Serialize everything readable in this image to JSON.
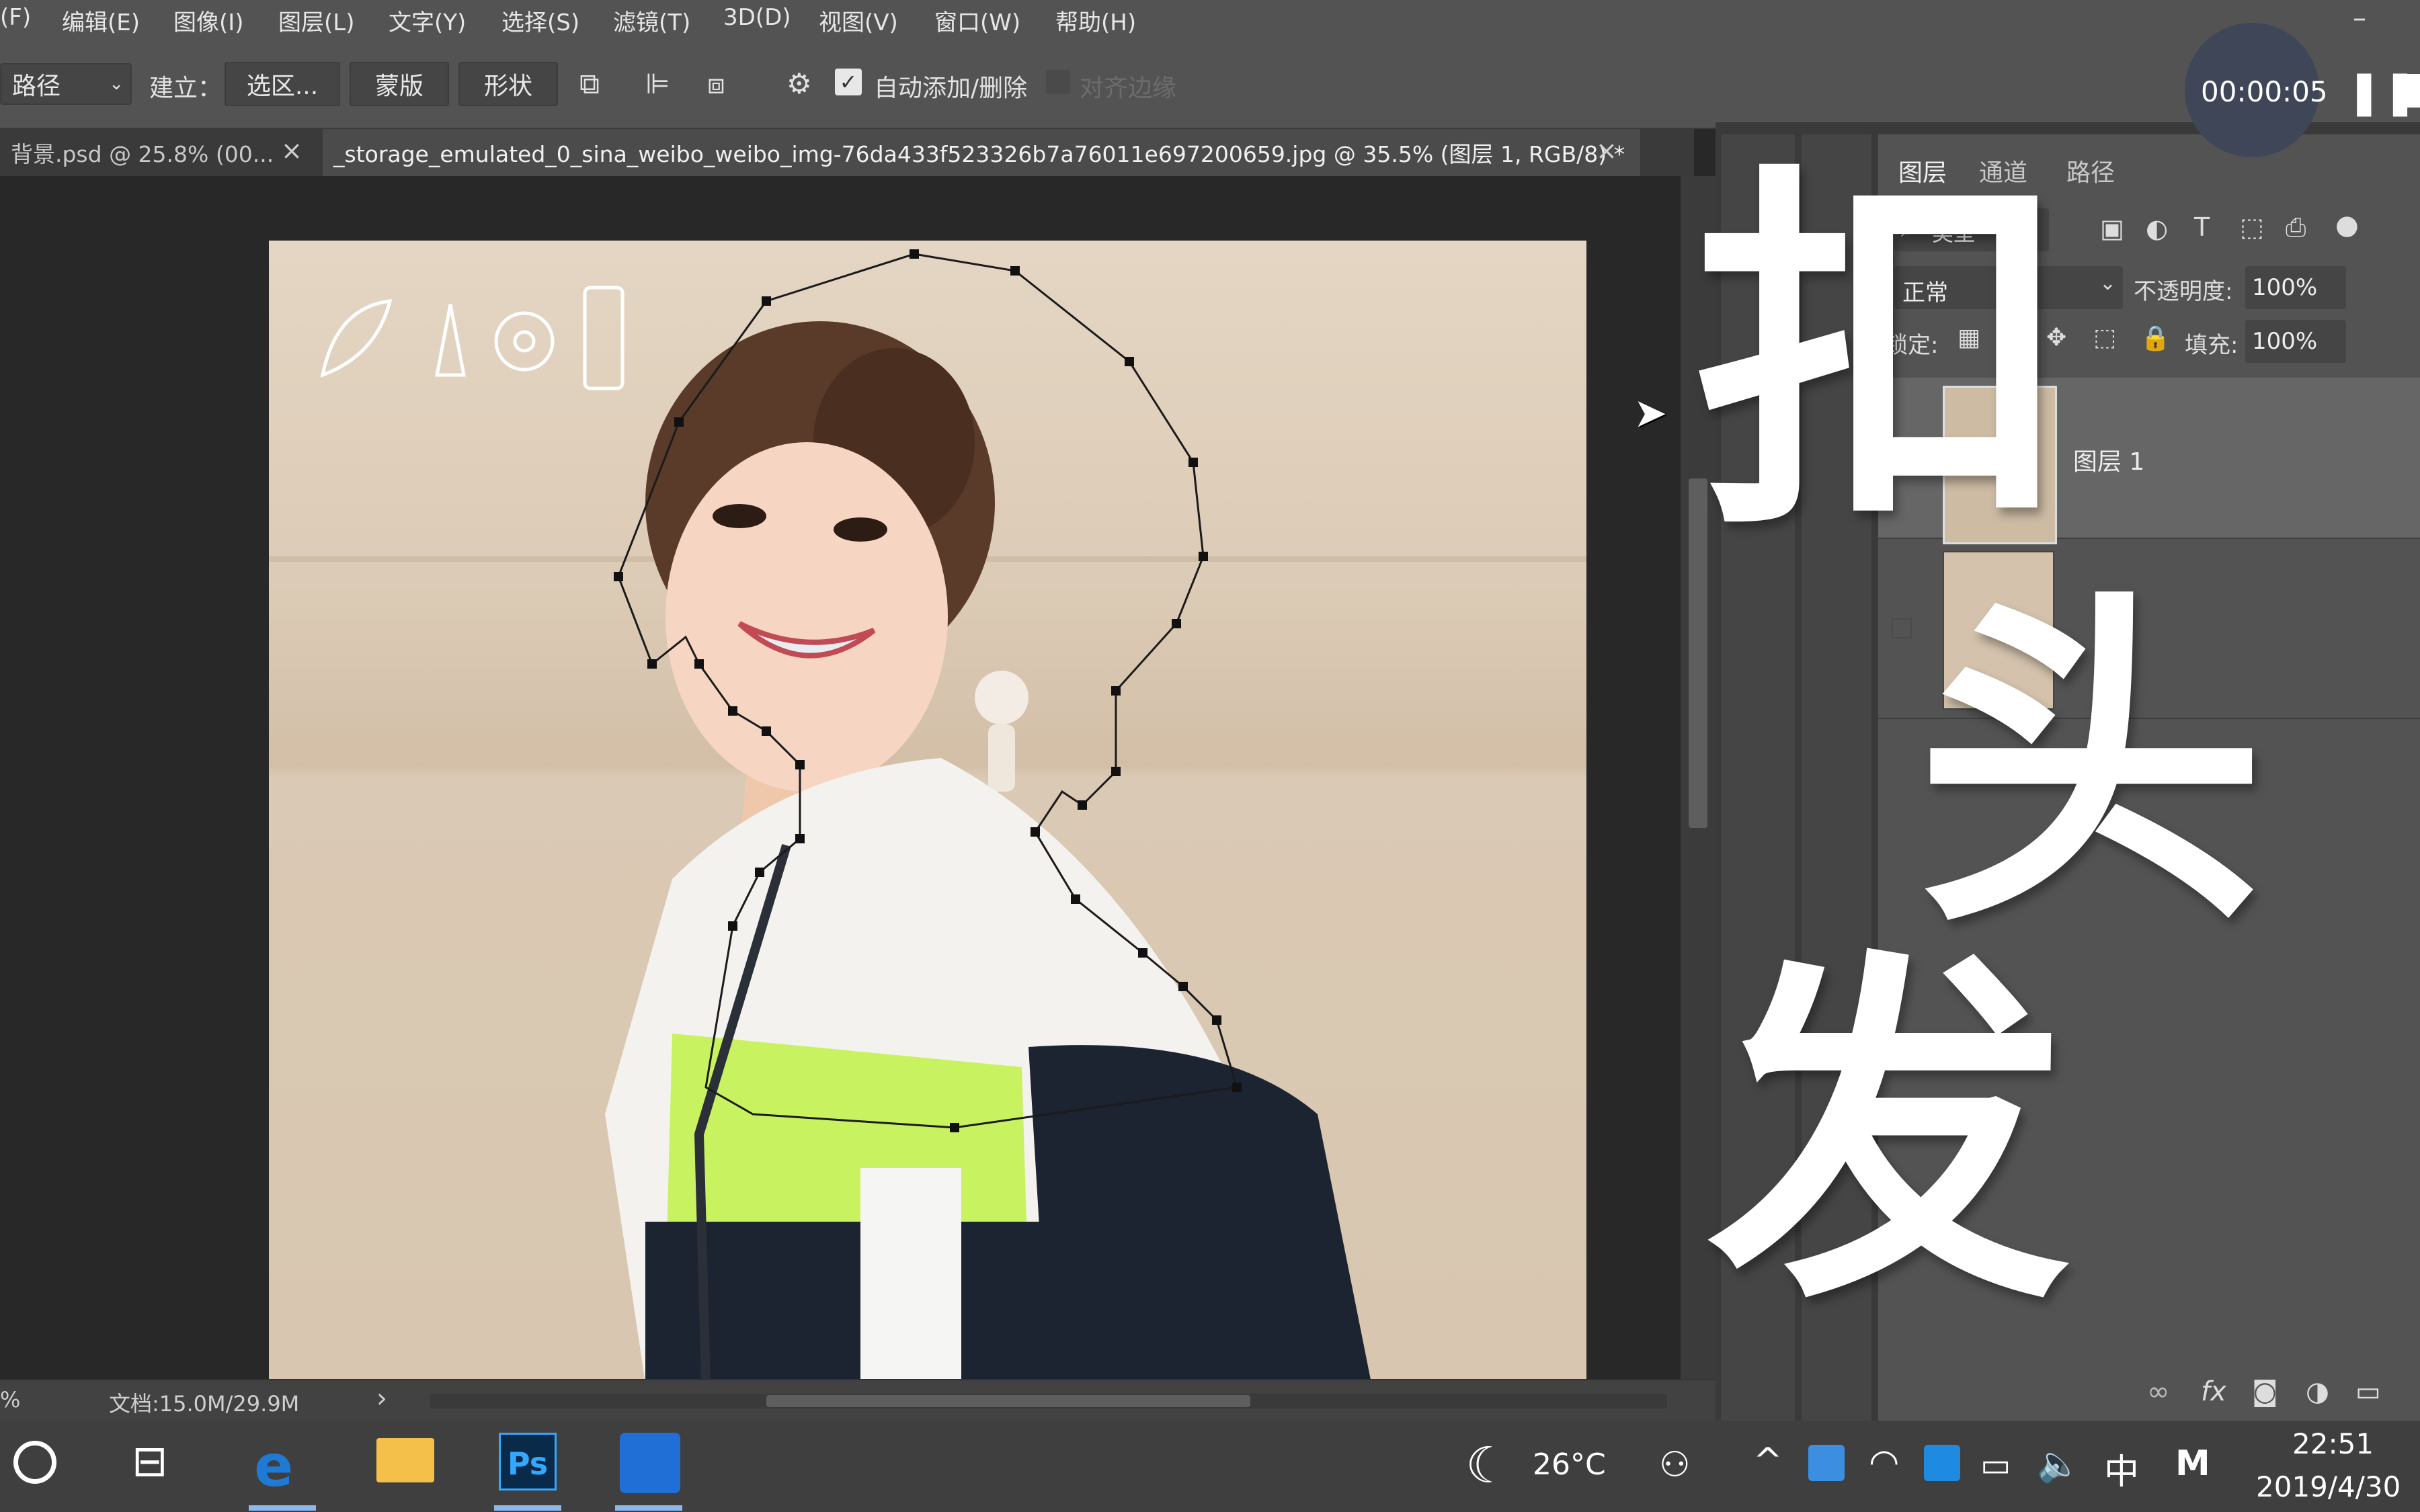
{
  "menu": [
    "(F)",
    "编辑(E)",
    "图像(I)",
    "图层(L)",
    "文字(Y)",
    "选择(S)",
    "滤镜(T)",
    "3D(D)",
    "视图(V)",
    "窗口(W)",
    "帮助(H)"
  ],
  "options": {
    "tool_mode": "路径",
    "make_label": "建立：",
    "selection_btn": "选区...",
    "mask_btn": "蒙版",
    "shape_btn": "形状",
    "auto_add_label": "自动添加/删除",
    "align_edges_label": "对齐边缘"
  },
  "tabs": [
    {
      "label": "背景.psd @ 25.8% (00...",
      "close": "×"
    },
    {
      "label": "_storage_emulated_0_sina_weibo_weibo_img-76da433f523326b7a76011e697200659.jpg @ 35.5% (图层 1, RGB/8) *",
      "close": "×"
    }
  ],
  "status": {
    "zoom": "%",
    "doc": "文档:15.0M/29.9M",
    "arrow": "›"
  },
  "recording": {
    "time": "00:00:05"
  },
  "layers_panel": {
    "tabs": [
      "图层",
      "通道",
      "路径"
    ],
    "filter_label": "类型",
    "blend_mode": "正常",
    "opacity_label": "不透明度:",
    "opacity_value": "100%",
    "lock_label": "锁定:",
    "fill_label": "填充:",
    "fill_value": "100%",
    "layers": [
      {
        "name": "图层 1",
        "visible": true
      },
      {
        "name": "",
        "visible": false
      }
    ]
  },
  "title_overlay": [
    "扣",
    "头",
    "发"
  ],
  "taskbar": {
    "weather_temp": "26°C",
    "ime_label": "中",
    "ime_mode": "M",
    "clock_time": "22:51",
    "clock_date": "2019/4/30"
  },
  "colors": {
    "ps_panel": "#535353",
    "ps_dark": "#282828",
    "accent_blue": "#1f6fd6",
    "title_white": "#ffffff"
  }
}
